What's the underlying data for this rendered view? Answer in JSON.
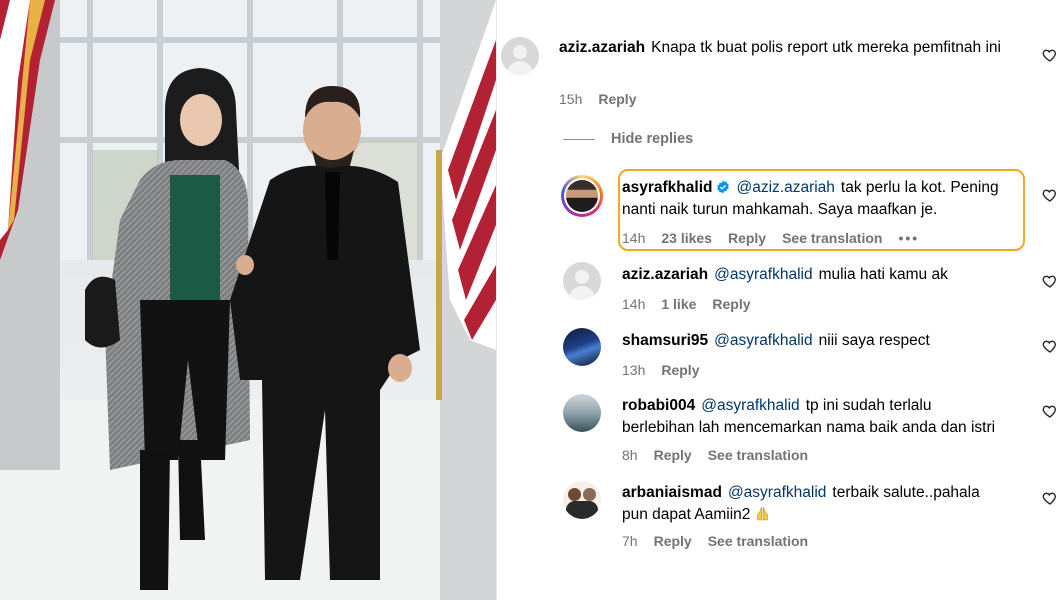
{
  "comments": [
    {
      "username": "aziz.azariah",
      "text": "Knapa tk buat polis report utk mereka pemfitnah ini",
      "time": "15h",
      "reply_label": "Reply"
    }
  ],
  "hide_replies_label": "Hide replies",
  "replies": [
    {
      "username": "asyrafkhalid",
      "verified": true,
      "mention": "@aziz.azariah",
      "text_line1": "tak perlu la kot. Pening",
      "text_line2": "nanti naik turun mahkamah. Saya maafkan je.",
      "time": "14h",
      "likes": "23 likes",
      "reply_label": "Reply",
      "translation_label": "See translation",
      "more": "•••"
    },
    {
      "username": "aziz.azariah",
      "mention": "@asyrafkhalid",
      "text": "mulia hati kamu ak",
      "time": "14h",
      "likes": "1 like",
      "reply_label": "Reply"
    },
    {
      "username": "shamsuri95",
      "mention": "@asyrafkhalid",
      "text": "niii saya respect",
      "time": "13h",
      "reply_label": "Reply"
    },
    {
      "username": "robabi004",
      "mention": "@asyrafkhalid",
      "text_line1": "tp ini sudah terlalu",
      "text_line2": "berlebihan lah mencemarkan nama baik anda dan istri",
      "time": "8h",
      "reply_label": "Reply",
      "translation_label": "See translation"
    },
    {
      "username": "arbaniaismad",
      "mention": "@asyrafkhalid",
      "text_line1": "terbaik salute..pahala",
      "text_line2": "pun dapat Aamiin2",
      "emoji": "praying-hands-emoji",
      "time": "7h",
      "reply_label": "Reply",
      "translation_label": "See translation"
    }
  ],
  "colors": {
    "highlight_border": "#f5a623",
    "mention": "#00376b",
    "meta": "#737373",
    "verified": "#0095f6"
  }
}
